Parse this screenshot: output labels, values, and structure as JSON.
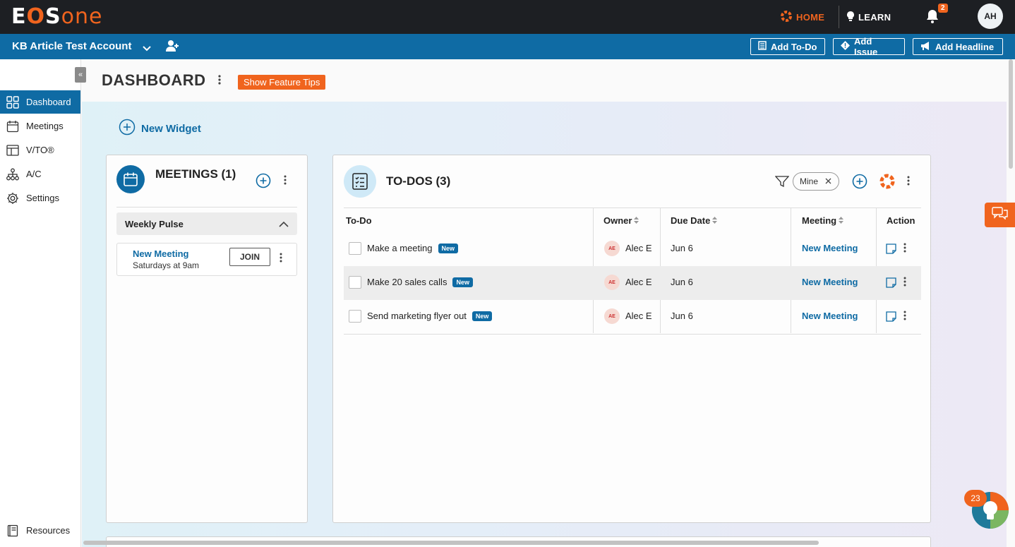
{
  "brand": {
    "logo_text_e": "E",
    "logo_text_o": "O",
    "logo_text_s": "S",
    "logo_text_one": "one"
  },
  "topnav": {
    "home": "HOME",
    "learn": "LEARN",
    "notifications_count": "2",
    "user_initials": "AH"
  },
  "account": {
    "name": "KB Article Test Account",
    "add_todo": "Add To-Do",
    "add_issue": "Add Issue",
    "add_headline": "Add Headline"
  },
  "sidebar": {
    "items": [
      {
        "label": "Dashboard",
        "icon": "grid-icon",
        "active": true
      },
      {
        "label": "Meetings",
        "icon": "calendar-icon"
      },
      {
        "label": "V/TO®",
        "icon": "table-icon"
      },
      {
        "label": "A/C",
        "icon": "org-chart-icon"
      },
      {
        "label": "Settings",
        "icon": "gear-icon"
      }
    ],
    "resources": "Resources"
  },
  "page": {
    "title": "DASHBOARD",
    "tips_button": "Show Feature Tips",
    "new_widget": "New Widget"
  },
  "meetings_widget": {
    "title": "MEETINGS (1)",
    "group": "Weekly Pulse",
    "items": [
      {
        "name": "New Meeting",
        "schedule": "Saturdays at 9am",
        "join": "JOIN"
      }
    ]
  },
  "todos_widget": {
    "title": "TO-DOS (3)",
    "filter_chip": "Mine",
    "columns": {
      "todo": "To-Do",
      "owner": "Owner",
      "due": "Due Date",
      "meeting": "Meeting",
      "action": "Action"
    },
    "rows": [
      {
        "name": "Make a meeting",
        "tag": "New",
        "owner_initials": "AE",
        "owner": "Alec E",
        "due": "Jun 6",
        "meeting": "New Meeting"
      },
      {
        "name": "Make 20 sales calls",
        "tag": "New",
        "owner_initials": "AE",
        "owner": "Alec E",
        "due": "Jun 6",
        "meeting": "New Meeting"
      },
      {
        "name": "Send marketing flyer out",
        "tag": "New",
        "owner_initials": "AE",
        "owner": "Alec E",
        "due": "Jun 6",
        "meeting": "New Meeting"
      }
    ]
  },
  "help": {
    "badge_count": "23"
  },
  "colors": {
    "brand_blue": "#0f6ba4",
    "brand_orange": "#f0641e",
    "topbar": "#1d1f23"
  }
}
